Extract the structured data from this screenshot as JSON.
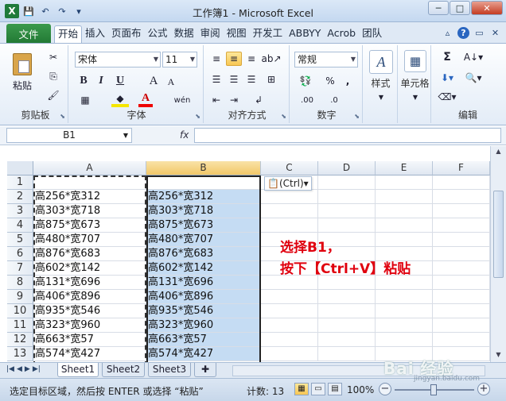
{
  "window": {
    "title": "工作簿1 - Microsoft Excel",
    "minimize": "─",
    "maximize": "□",
    "close": "✕"
  },
  "qat": {
    "logo": "X",
    "save": "💾",
    "undo": "↶",
    "redo": "↷",
    "customize": "▾"
  },
  "tabs": {
    "file": "文件",
    "items": [
      "开始",
      "插入",
      "页面布",
      "公式",
      "数据",
      "审阅",
      "视图",
      "开发工",
      "ABBYY",
      "Acrob",
      "团队"
    ],
    "active_index": 0
  },
  "ribbon": {
    "clipboard": {
      "label": "剪贴板",
      "paste": "粘贴",
      "cut_icon": "✂",
      "copy_icon": "⎘",
      "format_painter_icon": "🖌"
    },
    "font": {
      "label": "字体",
      "name": "宋体",
      "size": "11",
      "bold": "B",
      "italic": "I",
      "underline": "U",
      "grow": "A",
      "shrink": "A",
      "wen": "wén",
      "color_a": "A"
    },
    "alignment": {
      "label": "对齐方式"
    },
    "number": {
      "label": "数字",
      "format": "常规",
      "percent": "%",
      "comma": ",",
      "inc_decimal": ".00",
      "dec_decimal": ".0"
    },
    "styles": {
      "label": "样式"
    },
    "cells": {
      "label": "单元格"
    },
    "editing": {
      "label": "编辑",
      "sum": "Σ"
    }
  },
  "formula_bar": {
    "name_box": "B1",
    "fx": "fx",
    "content": ""
  },
  "columns": [
    "A",
    "B",
    "C",
    "D",
    "E",
    "F"
  ],
  "rows": [
    "1",
    "2",
    "3",
    "4",
    "5",
    "6",
    "7",
    "8",
    "9",
    "10",
    "11",
    "12",
    "13"
  ],
  "cells_a": [
    "",
    "高256*宽312",
    "高303*宽718",
    "高875*宽673",
    "高480*宽707",
    "高876*宽683",
    "高602*宽142",
    "高131*宽696",
    "高406*宽896",
    "高935*宽546",
    "高323*宽960",
    "高663*宽57",
    "高574*宽427"
  ],
  "cells_b": [
    "",
    "高256*宽312",
    "高303*宽718",
    "高875*宽673",
    "高480*宽707",
    "高876*宽683",
    "高602*宽142",
    "高131*宽696",
    "高406*宽896",
    "高935*宽546",
    "高323*宽960",
    "高663*宽57",
    "高574*宽427"
  ],
  "paste_options": "(Ctrl)▾",
  "annotation": {
    "line1": "选择B1，",
    "line2": "按下【Ctrl+V】粘贴"
  },
  "sheets": [
    "Sheet1",
    "Sheet2",
    "Sheet3"
  ],
  "status": {
    "message": "选定目标区域，然后按 ENTER 或选择 “粘贴”",
    "count": "计数: 13",
    "zoom": "100%"
  },
  "watermark": {
    "main": "Bai 经验",
    "sub": "jingyan.baidu.com"
  },
  "colors": {
    "file_tab": "#227a35",
    "selection_fill": "#c5dcf3",
    "annotation": "#e0000e"
  }
}
